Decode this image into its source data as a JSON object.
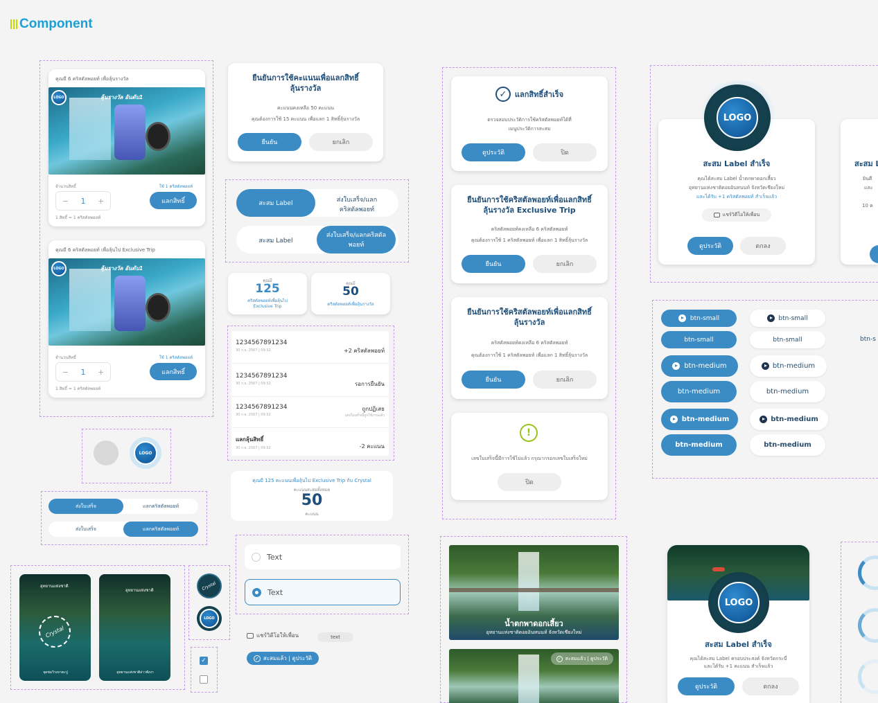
{
  "header": {
    "title": "Component"
  },
  "product_card_1": {
    "points_line": "คุณมี 6 คริสตัลพอยท์ เพื่อลุ้นรางวัล",
    "logo": "LOGO",
    "banner": "ลุ้นรางวัล อันดับ1",
    "qty_label": "จำนวนสิทธิ์",
    "rights_label": "ใช้ 1 คริสตัลพอยท์",
    "minus": "−",
    "qty": "1",
    "plus": "+",
    "redeem": "แลกสิทธิ์",
    "rate": "1 สิทธิ์ = 1 คริสตัลพอยท์"
  },
  "product_card_2": {
    "points_line": "คุณมี 6 คริสตัลพอยท์ เพื่อลุ้นไป Exclusive Trip",
    "logo": "LOGO",
    "banner": "ลุ้นรางวัล อันดับ1",
    "qty_label": "จำนวนสิทธิ์",
    "rights_label": "ใช้ 1 คริสตัลพอยท์",
    "minus": "−",
    "qty": "1",
    "plus": "+",
    "redeem": "แลกสิทธิ์",
    "rate": "1 สิทธิ์ = 1 คริสตัลพอยท์"
  },
  "avatars": {
    "logo": "LOGO"
  },
  "segmented_small": {
    "row1": [
      "ส่งใบเสร็จ",
      "แลกคริสตัลพอยท์"
    ],
    "row2": [
      "ส่งใบเสร็จ",
      "แลกคริสตัลพอยท์"
    ]
  },
  "confirm_dialog_1": {
    "title": "ยืนยันการใช้คะแนนเพื่อแลกสิทธิ์ลุ้นรางวัล",
    "line1": "คะแนนคงเหลือ 50 คะแนน",
    "line2": "คุณต้องการใช้ 15 คะแนน เพื่อแลก 1 สิทธิ์ลุ้นรางวัล",
    "confirm": "ยืนยัน",
    "cancel": "ยกเลิก"
  },
  "segmented_large": {
    "row1": [
      "สะสม Label",
      "ส่งใบเสร็จ/แลกคริสตัลพอยท์"
    ],
    "row2": [
      "สะสม Label",
      "ส่งใบเสร็จ/แลกคริสตัลพอยท์"
    ]
  },
  "stat_cards": [
    {
      "caption": "คุณมี",
      "value": "125",
      "sub": "คริสตัลพอยท์เพื่อลุ้นไป Exclusive Trip"
    },
    {
      "caption": "คุณมี",
      "value": "50",
      "sub": "คริสตัลพอยท์เพื่อลุ้นรางวัล"
    }
  ],
  "history": [
    {
      "id": "1234567891234",
      "date": "30 ก.ย. 2567 | 09:32",
      "value": "+2 คริสตัลพอยท์",
      "sub": ""
    },
    {
      "id": "1234567891234",
      "date": "30 ก.ย. 2567 | 09:32",
      "value": "รอการยืนยัน",
      "sub": ""
    },
    {
      "id": "1234567891234",
      "date": "30 ก.ย. 2567 | 09:32",
      "value": "ถูกปฏิเสธ",
      "sub": "เลขใบเสร็จนี้ถูกใช้งานแล้ว"
    },
    {
      "id": "แลกลุ้นสิทธิ์",
      "date": "30 ก.ย. 2567 | 09:32",
      "value": "-2 คะแนน",
      "sub": ""
    }
  ],
  "score_card": {
    "line": "คุณมี 125 คะแนนเพื่อลุ้นไป Exclusive Trip กับ Crystal",
    "caption": "คะแนนสะสมทั้งหมด",
    "value": "50",
    "unit": "คะแนน"
  },
  "success_dialog": {
    "title": "แลกสิทธิ์สำเร็จ",
    "line1": "ตรวจสอบประวัติการใช้คริสตัลพอยท์ได้ที่",
    "line2": "เมนูประวัติการสะสม",
    "primary": "ดูประวัติ",
    "secondary": "ปิด"
  },
  "confirm_dialog_2": {
    "title": "ยืนยันการใช้คริสตัลพอยท์เพื่อแลกสิทธิ์ลุ้นรางวัล Exclusive Trip",
    "line1": "คริสตัลพอยท์คงเหลือ 6 คริสตัลพอยท์",
    "line2": "คุณต้องการใช้ 1 คริสตัลพอยท์ เพื่อแลก 1 สิทธิ์ลุ้นรางวัล",
    "confirm": "ยืนยัน",
    "cancel": "ยกเลิก"
  },
  "confirm_dialog_3": {
    "title": "ยืนยันการใช้คริสตัลพอยท์เพื่อแลกสิทธิ์ลุ้นรางวัล",
    "line1": "คริสตัลพอยท์คงเหลือ 6 คริสตัลพอยท์",
    "line2": "คุณต้องการใช้ 1 คริสตัลพอยท์ เพื่อแลก 1 สิทธิ์ลุ้นรางวัล",
    "confirm": "ยืนยัน",
    "cancel": "ยกเลิก"
  },
  "warning_dialog": {
    "message": "เลขใบเสร็จนี้มีการใช้ไปแล้ว กรุณากรอกเลขใบเสร็จใหม่",
    "close": "ปิด"
  },
  "collect_card": {
    "logo": "LOGO",
    "title": "สะสม Label สำเร็จ",
    "line1": "คุณได้สะสม Label น้ำตกพาดอกเสี้ยว",
    "line2": "อุทยานแห่งชาติดอยอินทนนท์ จังหวัดเชียงใหม่",
    "line3": "และได้รับ +1 คริสตัลพอยท์ สำเร็จแล้ว",
    "share": "แชร์วิดีโอให้เพื่อน",
    "primary": "ดูประวัติ",
    "secondary": "ตกลง"
  },
  "collect_card_partial": {
    "title": "สะสม L",
    "line1": "ยินดี",
    "line2": "และ",
    "line3": "10 ค"
  },
  "button_sizes": {
    "rows": [
      [
        "btn-small",
        "btn-small"
      ],
      [
        "btn-small",
        "btn-small"
      ],
      [
        "btn-medium",
        "btn-medium"
      ],
      [
        "btn-medium",
        "btn-medium"
      ],
      [
        "btn-medium",
        "btn-medium"
      ],
      [
        "btn-medium",
        "btn-medium"
      ]
    ],
    "overflow": "btn-s"
  },
  "story_cards": [
    {
      "badge": "Crystal",
      "caption": "อุทยานแห่งชาติ",
      "footer": "จุดชมวิวเขาตะปู"
    },
    {
      "badge": "",
      "caption": "อุทยานแห่งชาติ",
      "footer": "อุทยานแห่งชาติอ่าวพังงา"
    }
  ],
  "badge_avatars": {
    "crystal": "Crystal",
    "logo": "LOGO"
  },
  "radio_inputs": [
    "Text",
    "Text"
  ],
  "chips": {
    "share": "แชร์วิดีโอให้เพื่อน",
    "text": "text",
    "collected": "สะสมแล้ว | ดูประวัติ"
  },
  "location_card": {
    "title": "น้ำตกพาดอกเสี้ยว",
    "subtitle": "อุทยานแห่งชาติดอยอินทนนท์ จังหวัดเชียงใหม่",
    "badge": "สะสมแล้ว | ดูประวัติ"
  },
  "collect_card_2": {
    "logo": "LOGO",
    "title": "สะสม Label สำเร็จ",
    "line1": "คุณได้สะสม Label ครอบประสงค์ จังหวัดกระบี่",
    "line2": "และได้รับ +1 คะแนน สำเร็จแล้ว",
    "primary": "ดูประวัติ",
    "secondary": "ตกลง"
  },
  "colors": {
    "primary": "#3b8bc5",
    "navy": "#1f4f7a",
    "accent": "#1a9fd6",
    "dash": "#c49be8",
    "warning": "#9bc31e"
  }
}
